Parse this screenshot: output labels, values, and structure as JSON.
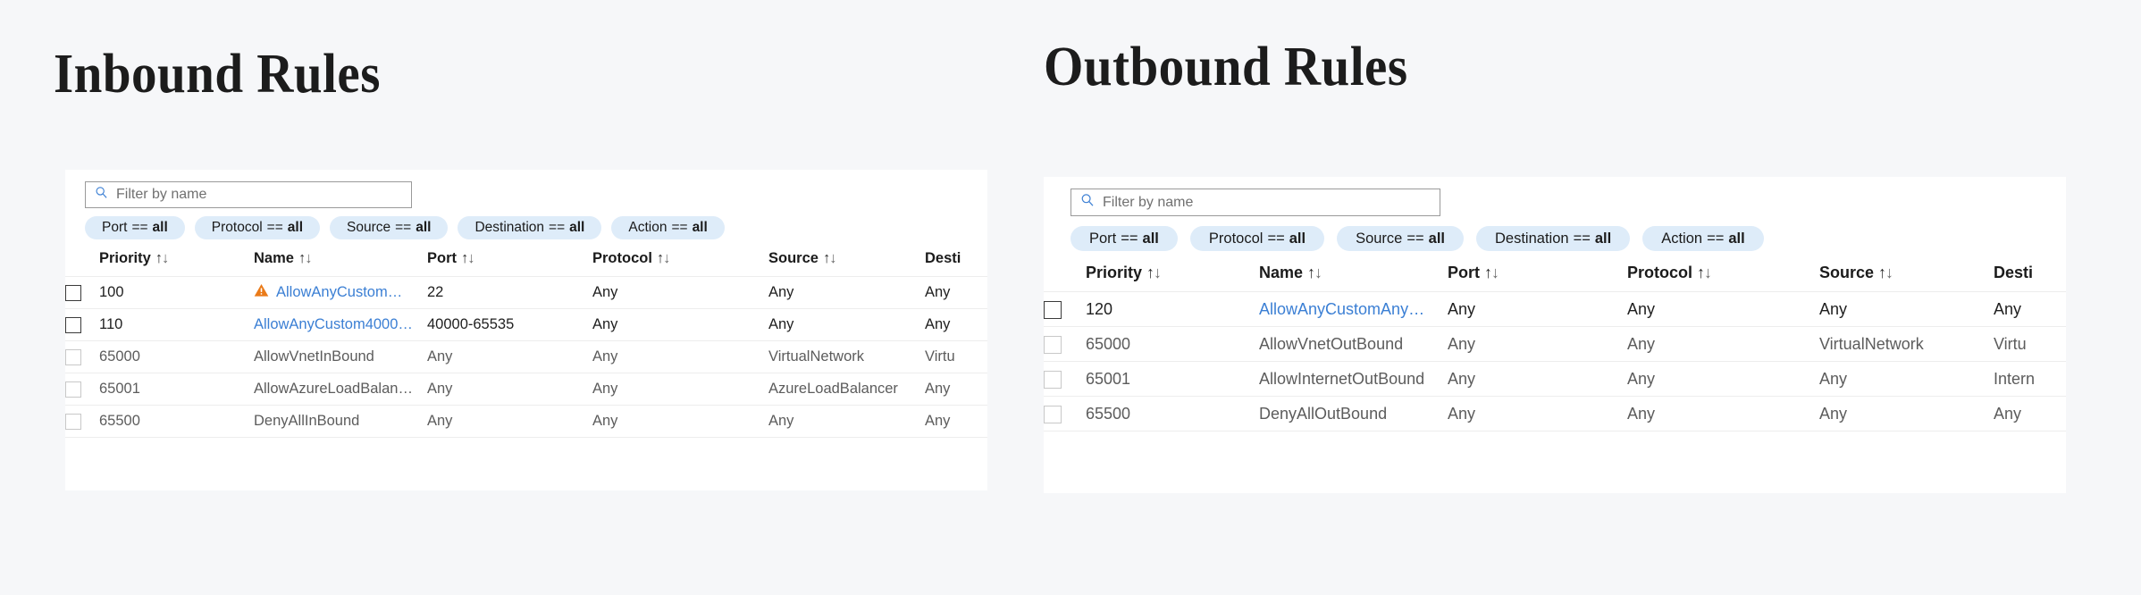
{
  "background_color": "#f6f7f9",
  "accent_link_color": "#3b7fd4",
  "chip_color": "#deecf9",
  "warning_color": "#ea7a18",
  "panels": [
    {
      "key": "inbound",
      "title": "Inbound Rules",
      "search": {
        "placeholder": "Filter by name",
        "value": "",
        "icon": "search-icon"
      },
      "chips": [
        {
          "field": "Port",
          "op": "==",
          "value": "all"
        },
        {
          "field": "Protocol",
          "op": "==",
          "value": "all"
        },
        {
          "field": "Source",
          "op": "==",
          "value": "all"
        },
        {
          "field": "Destination",
          "op": "==",
          "value": "all"
        },
        {
          "field": "Action",
          "op": "==",
          "value": "all"
        }
      ],
      "columns": [
        "Priority",
        "Name",
        "Port",
        "Protocol",
        "Source",
        "Desti"
      ],
      "rows": [
        {
          "checked": false,
          "checkbox_strong": true,
          "priority": "100",
          "name": "AllowAnyCustom…",
          "name_link": true,
          "warning": true,
          "port": "22",
          "protocol": "Any",
          "source": "Any",
          "destination": "Any",
          "emphasis": true
        },
        {
          "checked": false,
          "checkbox_strong": true,
          "priority": "110",
          "name": "AllowAnyCustom4000…",
          "name_link": true,
          "warning": false,
          "port": "40000-65535",
          "protocol": "Any",
          "source": "Any",
          "destination": "Any",
          "emphasis": true
        },
        {
          "checked": false,
          "checkbox_strong": false,
          "priority": "65000",
          "name": "AllowVnetInBound",
          "name_link": false,
          "warning": false,
          "port": "Any",
          "protocol": "Any",
          "source": "VirtualNetwork",
          "destination": "Virtu",
          "emphasis": false
        },
        {
          "checked": false,
          "checkbox_strong": false,
          "priority": "65001",
          "name": "AllowAzureLoadBalan…",
          "name_link": false,
          "warning": false,
          "port": "Any",
          "protocol": "Any",
          "source": "AzureLoadBalancer",
          "destination": "Any",
          "emphasis": false
        },
        {
          "checked": false,
          "checkbox_strong": false,
          "priority": "65500",
          "name": "DenyAllInBound",
          "name_link": false,
          "warning": false,
          "port": "Any",
          "protocol": "Any",
          "source": "Any",
          "destination": "Any",
          "emphasis": false
        }
      ]
    },
    {
      "key": "outbound",
      "title": "Outbound Rules",
      "search": {
        "placeholder": "Filter by name",
        "value": "",
        "icon": "search-icon"
      },
      "chips": [
        {
          "field": "Port",
          "op": "==",
          "value": "all"
        },
        {
          "field": "Protocol",
          "op": "==",
          "value": "all"
        },
        {
          "field": "Source",
          "op": "==",
          "value": "all"
        },
        {
          "field": "Destination",
          "op": "==",
          "value": "all"
        },
        {
          "field": "Action",
          "op": "==",
          "value": "all"
        }
      ],
      "columns": [
        "Priority",
        "Name",
        "Port",
        "Protocol",
        "Source",
        "Desti"
      ],
      "rows": [
        {
          "checked": false,
          "checkbox_strong": true,
          "priority": "120",
          "name": "AllowAnyCustomAny…",
          "name_link": true,
          "warning": false,
          "port": "Any",
          "protocol": "Any",
          "source": "Any",
          "destination": "Any",
          "emphasis": true
        },
        {
          "checked": false,
          "checkbox_strong": false,
          "priority": "65000",
          "name": "AllowVnetOutBound",
          "name_link": false,
          "warning": false,
          "port": "Any",
          "protocol": "Any",
          "source": "VirtualNetwork",
          "destination": "Virtu",
          "emphasis": false
        },
        {
          "checked": false,
          "checkbox_strong": false,
          "priority": "65001",
          "name": "AllowInternetOutBound",
          "name_link": false,
          "warning": false,
          "port": "Any",
          "protocol": "Any",
          "source": "Any",
          "destination": "Intern",
          "emphasis": false
        },
        {
          "checked": false,
          "checkbox_strong": false,
          "priority": "65500",
          "name": "DenyAllOutBound",
          "name_link": false,
          "warning": false,
          "port": "Any",
          "protocol": "Any",
          "source": "Any",
          "destination": "Any",
          "emphasis": false
        }
      ]
    }
  ],
  "sort_icon": {
    "ascending": "↑",
    "descending": "↓"
  }
}
